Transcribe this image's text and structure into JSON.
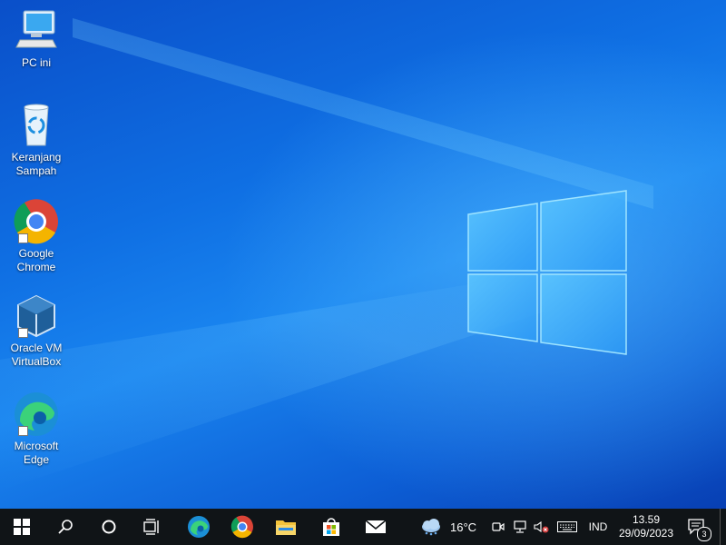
{
  "desktop": {
    "icons": [
      {
        "label_line1": "PC ini",
        "label_line2": "",
        "icon": "computer-icon"
      },
      {
        "label_line1": "Keranjang",
        "label_line2": "Sampah",
        "icon": "recycle-bin-icon"
      },
      {
        "label_line1": "Google",
        "label_line2": "Chrome",
        "icon": "chrome-icon"
      },
      {
        "label_line1": "Oracle VM",
        "label_line2": "VirtualBox",
        "icon": "virtualbox-icon"
      },
      {
        "label_line1": "Microsoft",
        "label_line2": "Edge",
        "icon": "edge-icon"
      }
    ]
  },
  "taskbar": {
    "pinned": [
      "start-icon",
      "search-icon",
      "cortana-icon",
      "task-view-icon",
      "edge-icon",
      "chrome-icon",
      "file-explorer-icon",
      "microsoft-store-icon",
      "mail-icon"
    ],
    "weather": {
      "temp": "16°C",
      "icon": "weather-cloud-icon"
    },
    "language": "IND",
    "time": "13.59",
    "date": "29/09/2023",
    "notification_count": "3"
  },
  "colors": {
    "accent": "#0f6fe3",
    "taskbar": "#101417"
  }
}
